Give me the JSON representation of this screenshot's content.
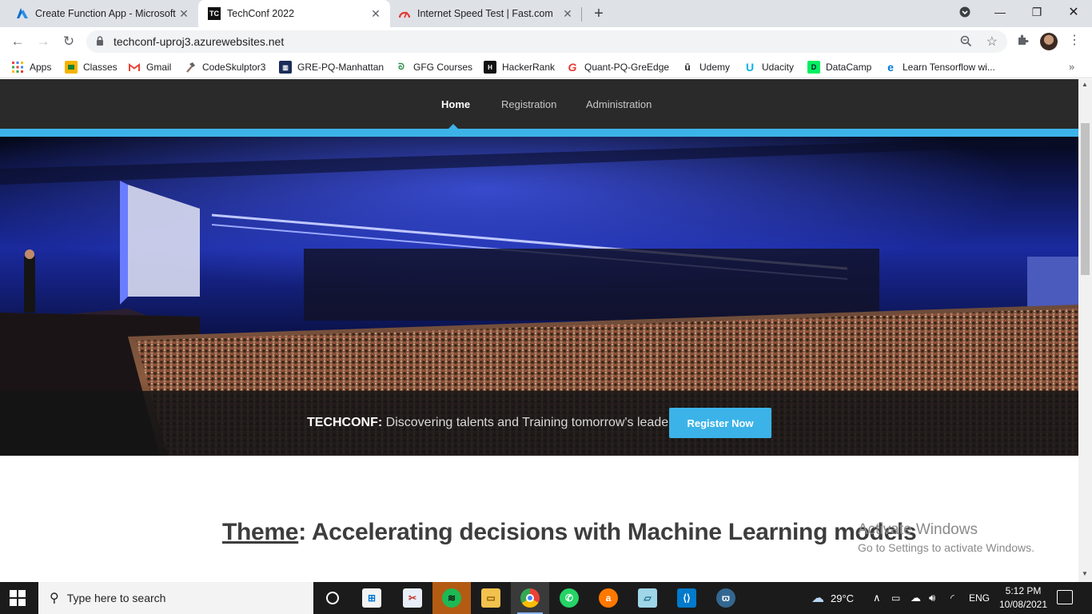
{
  "browser": {
    "tabs": [
      {
        "title": "Create Function App - Microsoft",
        "favicon": "azure-icon",
        "active": false
      },
      {
        "title": "TechConf 2022",
        "favicon": "TC",
        "active": true
      },
      {
        "title": "Internet Speed Test | Fast.com",
        "favicon": "fast-icon",
        "active": false
      }
    ],
    "url": "techconf-uproj3.azurewebsites.net",
    "bookmarks": [
      {
        "label": "Apps",
        "icon": "apps-grid-icon"
      },
      {
        "label": "Classes",
        "icon": "classroom-icon"
      },
      {
        "label": "Gmail",
        "icon": "gmail-icon"
      },
      {
        "label": "CodeSkulptor3",
        "icon": "hammer-icon"
      },
      {
        "label": "GRE-PQ-Manhattan",
        "icon": "manhattan-icon"
      },
      {
        "label": "GFG Courses",
        "icon": "gfg-icon"
      },
      {
        "label": "HackerRank",
        "icon": "hackerrank-icon"
      },
      {
        "label": "Quant-PQ-GreEdge",
        "icon": "greedge-icon"
      },
      {
        "label": "Udemy",
        "icon": "udemy-icon"
      },
      {
        "label": "Udacity",
        "icon": "udacity-icon"
      },
      {
        "label": "DataCamp",
        "icon": "datacamp-icon"
      },
      {
        "label": "Learn Tensorflow wi...",
        "icon": "edge-icon"
      }
    ]
  },
  "site": {
    "nav": [
      {
        "label": "Home",
        "active": true
      },
      {
        "label": "Registration",
        "active": false
      },
      {
        "label": "Administration",
        "active": false
      }
    ],
    "banner": {
      "brand": "TECHCONF:",
      "tagline": " Discovering talents and Training tomorrow's leaders",
      "cta": "Register Now"
    },
    "theme": {
      "label": "Theme",
      "text": ": Accelerating decisions with Machine Learning models"
    }
  },
  "watermark": {
    "line1": "Activate Windows",
    "line2": "Go to Settings to activate Windows."
  },
  "taskbar": {
    "search_placeholder": "Type here to search",
    "weather": "29°C",
    "language": "ENG",
    "time": "5:12 PM",
    "date": "10/08/2021"
  },
  "colors": {
    "accent": "#3cb3e8",
    "nav_bg": "#2a2a2a"
  }
}
